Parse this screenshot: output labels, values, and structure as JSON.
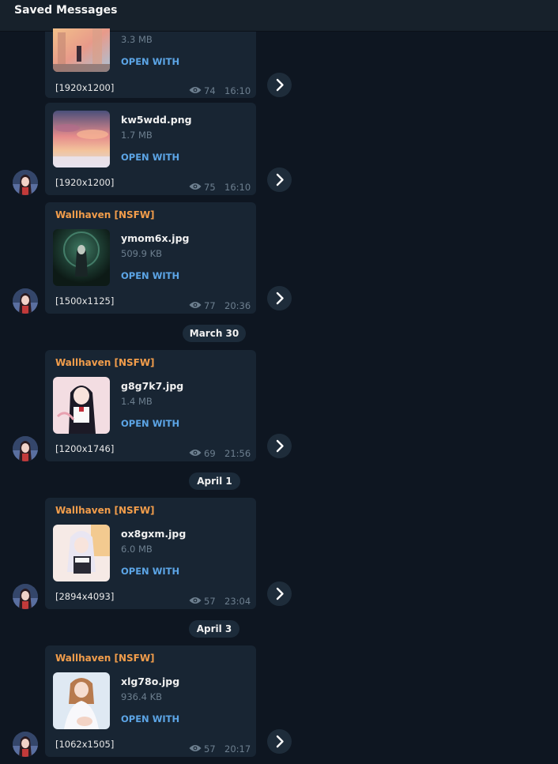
{
  "header": {
    "title": "Saved Messages"
  },
  "icons": {
    "eye": "eye-icon",
    "forward": "chevron-right-icon",
    "avatar": "avatar"
  },
  "colors": {
    "background": "#0e1621",
    "bubble": "#182533",
    "sender": "#f29d4b",
    "link": "#5ca5e6",
    "muted": "#6d7f8f"
  },
  "messages": [
    {
      "sender": "",
      "file_name": "",
      "file_size": "3.3 MB",
      "open_with": "OPEN WITH",
      "caption": "[1920x1200]",
      "views": "74",
      "time": "16:10"
    },
    {
      "sender": "",
      "file_name": "kw5wdd.png",
      "file_size": "1.7 MB",
      "open_with": "OPEN WITH",
      "caption": "[1920x1200]",
      "views": "75",
      "time": "16:10"
    },
    {
      "sender": "Wallhaven [NSFW]",
      "file_name": "ymom6x.jpg",
      "file_size": "509.9 KB",
      "open_with": "OPEN WITH",
      "caption": "[1500x1125]",
      "views": "77",
      "time": "20:36"
    },
    {
      "sender": "Wallhaven [NSFW]",
      "file_name": "g8g7k7.jpg",
      "file_size": "1.4 MB",
      "open_with": "OPEN WITH",
      "caption": "[1200x1746]",
      "views": "69",
      "time": "21:56"
    },
    {
      "sender": "Wallhaven [NSFW]",
      "file_name": "ox8gxm.jpg",
      "file_size": "6.0 MB",
      "open_with": "OPEN WITH",
      "caption": "[2894x4093]",
      "views": "57",
      "time": "23:04"
    },
    {
      "sender": "Wallhaven [NSFW]",
      "file_name": "xlg78o.jpg",
      "file_size": "936.4 KB",
      "open_with": "OPEN WITH",
      "caption": "[1062x1505]",
      "views": "57",
      "time": "20:17"
    }
  ],
  "date_separators": [
    "March 30",
    "April 1",
    "April 3"
  ]
}
